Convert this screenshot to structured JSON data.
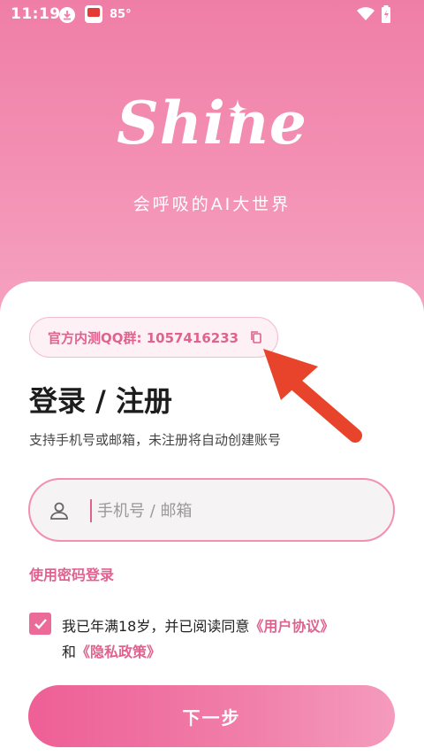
{
  "status_bar": {
    "time": "11:19",
    "temperature": "85°",
    "icons": [
      "download-icon",
      "app-notification-icon",
      "wifi-icon",
      "battery-charging-icon"
    ]
  },
  "hero": {
    "logo": "Shine",
    "slogan": "会呼吸的AI大世界"
  },
  "qq_group": {
    "label": "官方内测QQ群: 1057416233",
    "icon": "copy-icon"
  },
  "login": {
    "title": "登录 / 注册",
    "subtitle": "支持手机号或邮箱，未注册将自动创建账号",
    "input_placeholder": "手机号 / 邮箱",
    "input_value": "",
    "password_login_link": "使用密码登录",
    "agreement_prefix": "我已年满18岁，并已阅读同意",
    "user_agreement": "《用户协议》",
    "agreement_and": "和",
    "privacy_policy": "《隐私政策》",
    "agree_checked": true,
    "next_button": "下一步"
  },
  "colors": {
    "brand_pink": "#e0628f",
    "hero_top": "#ef7ea6",
    "annotation_arrow": "#e8442c"
  }
}
